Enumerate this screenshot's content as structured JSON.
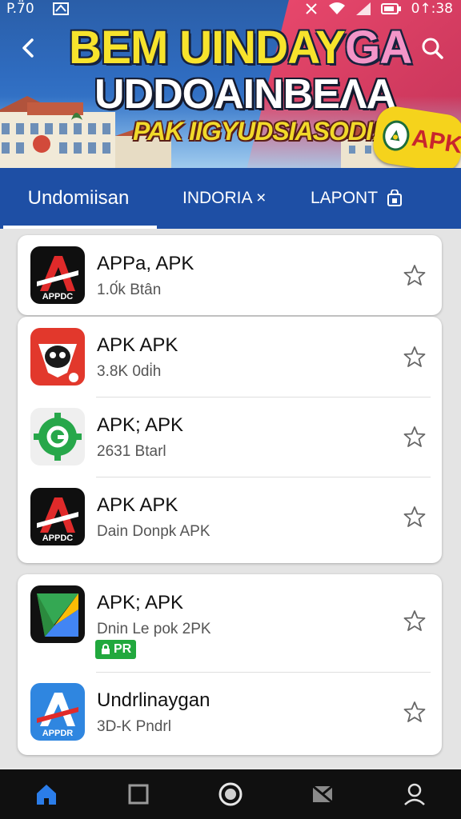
{
  "status_bar": {
    "time_left": "P.7̈0",
    "time_right": "0↑:38"
  },
  "banner": {
    "line1_main": "BEM UINDAY",
    "line1_accent": "GA",
    "line2": "UDDOAINBEΛA",
    "line3": "PAK IIGYUDSIASODI!",
    "apk_badge": "APK"
  },
  "tabs": [
    {
      "label": "Undomiisan",
      "active": true
    },
    {
      "label": "INDORIA ×",
      "active": false
    },
    {
      "label": "LAPONT",
      "active": false
    }
  ],
  "apps": [
    {
      "name": "APPa, APK",
      "sub": "1.0́k Btân",
      "icon": "red-a-logo-icon"
    },
    {
      "name": "APK APK",
      "sub": "3.8K 0di̇h",
      "icon": "red-mascot-icon"
    },
    {
      "name": "APK; APK",
      "sub": "2631 Btarl",
      "icon": "green-gear-icon"
    },
    {
      "name": "APK APK",
      "sub": "Dain Donpk APK",
      "icon": "red-a-logo-icon"
    },
    {
      "name": "APK; APK",
      "sub": "Dnin Le pok 2PK",
      "icon": "play-triangle-icon",
      "badge": "PR"
    },
    {
      "name": "Undrlinaygan",
      "sub": "3D-K Pndrl",
      "icon": "blue-a-logo-icon"
    }
  ],
  "colors": {
    "tab_bar": "#1e4fa5",
    "accent_yellow": "#f5d31c",
    "badge_green": "#21a83d"
  }
}
